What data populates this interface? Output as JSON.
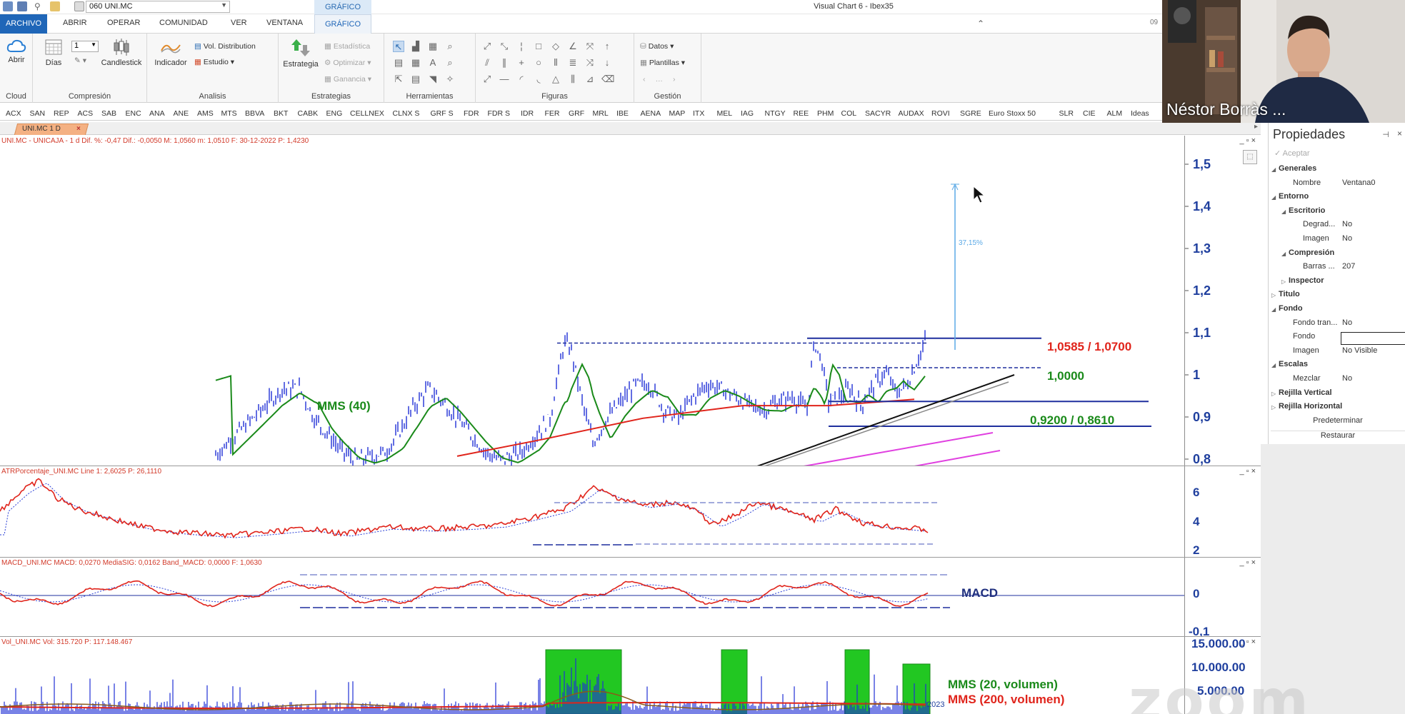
{
  "app": {
    "title": "Visual Chart 6 - Ibex35",
    "symbol_input": "060 UNI.MC",
    "contextual_tab_label": "GRÁFICO",
    "clock": "09"
  },
  "menu": {
    "tabs": [
      "ARCHIVO",
      "ABRIR",
      "OPERAR",
      "COMUNIDAD",
      "VER",
      "VENTANA",
      "GRÁFICO"
    ],
    "active": "GRÁFICO"
  },
  "ribbon": {
    "cloud": {
      "open_label": "Abrir",
      "group_label": "Cloud"
    },
    "compression": {
      "days_label": "Días",
      "value": "1",
      "candlestick_label": "Candlestick",
      "group_label": "Compresión"
    },
    "analysis": {
      "indicator_label": "Indicador",
      "vol_dist_label": "Vol. Distribution",
      "study_label": "Estudio",
      "group_label": "Analisis"
    },
    "strategies": {
      "strategy_label": "Estrategia",
      "stats_label": "Estadística",
      "optimize_label": "Optimizar",
      "gain_label": "Ganancia",
      "group_label": "Estrategias"
    },
    "tools": {
      "group_label": "Herramientas"
    },
    "figures": {
      "group_label": "Figuras"
    },
    "management": {
      "data_label": "Datos",
      "templates_label": "Plantillas",
      "group_label": "Gestión"
    }
  },
  "symbols": [
    "ACX",
    "SAN",
    "REP",
    "ACS",
    "SAB",
    "ENC",
    "ANA",
    "ANE",
    "AMS",
    "MTS",
    "BBVA",
    "BKT",
    "CABK",
    "ENG",
    "CELLNEX",
    "CLNX S",
    "GRF S",
    "FDR",
    "FDR S",
    "IDR",
    "FER",
    "GRF",
    "MRL",
    "IBE",
    "AENA",
    "MAP",
    "ITX",
    "MEL",
    "IAG",
    "NTGY",
    "REE",
    "PHM",
    "COL",
    "SACYR",
    "AUDAX",
    "ROVI",
    "SGRE",
    "Euro Stoxx 50",
    "SLR",
    "CIE",
    "ALM",
    "Ideas"
  ],
  "chart_tab": {
    "label": "UNI.MC 1 D"
  },
  "price_panel": {
    "info": "UNI.MC - UNICAJA - 1 d  Dif. %: -0,47  Dif.: -0,0050  M: 1,0560  m: 1,0510  F: 30-12-2022  P: 1,4230",
    "axis_ticks": [
      "1,5",
      "1,4",
      "1,3",
      "1,2",
      "1,1",
      "1",
      "0,9",
      "0,8"
    ],
    "annotations": {
      "mms": "MMS (40)",
      "resistance": "1,0585 / 1,0700",
      "level": "1,0000",
      "support": "0,9200 / 0,8610",
      "target_pct": "37,15%"
    },
    "colors": {
      "price": "#1f2fd6",
      "mms40": "#1a8a1a",
      "mms_long": "#e0241b",
      "trend": "#111111",
      "channel": "#e040e0",
      "target": "#5aa9e6"
    }
  },
  "atr_panel": {
    "info": "ATRPorcentaje_UNI.MC  Line 1: 2,6025  P: 26,1110",
    "axis_ticks": [
      "6",
      "4",
      "2"
    ]
  },
  "macd_panel": {
    "info": "MACD_UNI.MC  MACD: 0,0270  MediaSIG: 0,0162  Band_MACD: 0,0000  F: 1,0630",
    "axis_ticks": [
      "0",
      "-0,1"
    ],
    "label": "MACD"
  },
  "volume_panel": {
    "info": "Vol_UNI.MC  Vol: 315.720  P: 117.148.467",
    "axis_ticks": [
      "15.000.00",
      "10.000.00",
      "5.000.00"
    ],
    "legend_short": "MMS (20, volumen)",
    "legend_long": "MMS (200, volumen)",
    "year_label": "2023"
  },
  "properties": {
    "title": "Propiedades",
    "accept_label": "Aceptar",
    "rows": [
      {
        "key": "Generales",
        "value": "",
        "level": 0,
        "bold": true,
        "expanded": true
      },
      {
        "key": "Nombre",
        "value": "Ventana0",
        "level": 1,
        "bold": false
      },
      {
        "key": "Entorno",
        "value": "",
        "level": 0,
        "bold": true,
        "expanded": true
      },
      {
        "key": "Escritorio",
        "value": "",
        "level": 1,
        "bold": true,
        "expanded": true
      },
      {
        "key": "Degrad...",
        "value": "No",
        "level": 2,
        "bold": false
      },
      {
        "key": "Imagen",
        "value": "No",
        "level": 2,
        "bold": false
      },
      {
        "key": "Compresión",
        "value": "",
        "level": 1,
        "bold": true,
        "expanded": true
      },
      {
        "key": "Barras ...",
        "value": "207",
        "level": 2,
        "bold": false
      },
      {
        "key": "Inspector",
        "value": "",
        "level": 1,
        "bold": true,
        "expanded": false
      },
      {
        "key": "Titulo",
        "value": "",
        "level": 0,
        "bold": true,
        "expanded": false
      },
      {
        "key": "Fondo",
        "value": "",
        "level": 0,
        "bold": true,
        "expanded": true
      },
      {
        "key": "Fondo tran...",
        "value": "No",
        "level": 1,
        "bold": false
      },
      {
        "key": "Fondo",
        "value": "",
        "level": 1,
        "bold": false
      },
      {
        "key": "Imagen",
        "value": "No Visible",
        "level": 1,
        "bold": false
      },
      {
        "key": "Escalas",
        "value": "",
        "level": 0,
        "bold": true,
        "expanded": true
      },
      {
        "key": "Mezclar",
        "value": "No",
        "level": 1,
        "bold": false
      },
      {
        "key": "Rejilla Vertical",
        "value": "",
        "level": 0,
        "bold": true,
        "expanded": false
      },
      {
        "key": "Rejilla Horizontal",
        "value": "",
        "level": 0,
        "bold": true,
        "expanded": false
      }
    ],
    "default_label": "Predeterminar",
    "restore_label": "Restaurar"
  },
  "webcam": {
    "name": "Néstor Borràs ..."
  }
}
